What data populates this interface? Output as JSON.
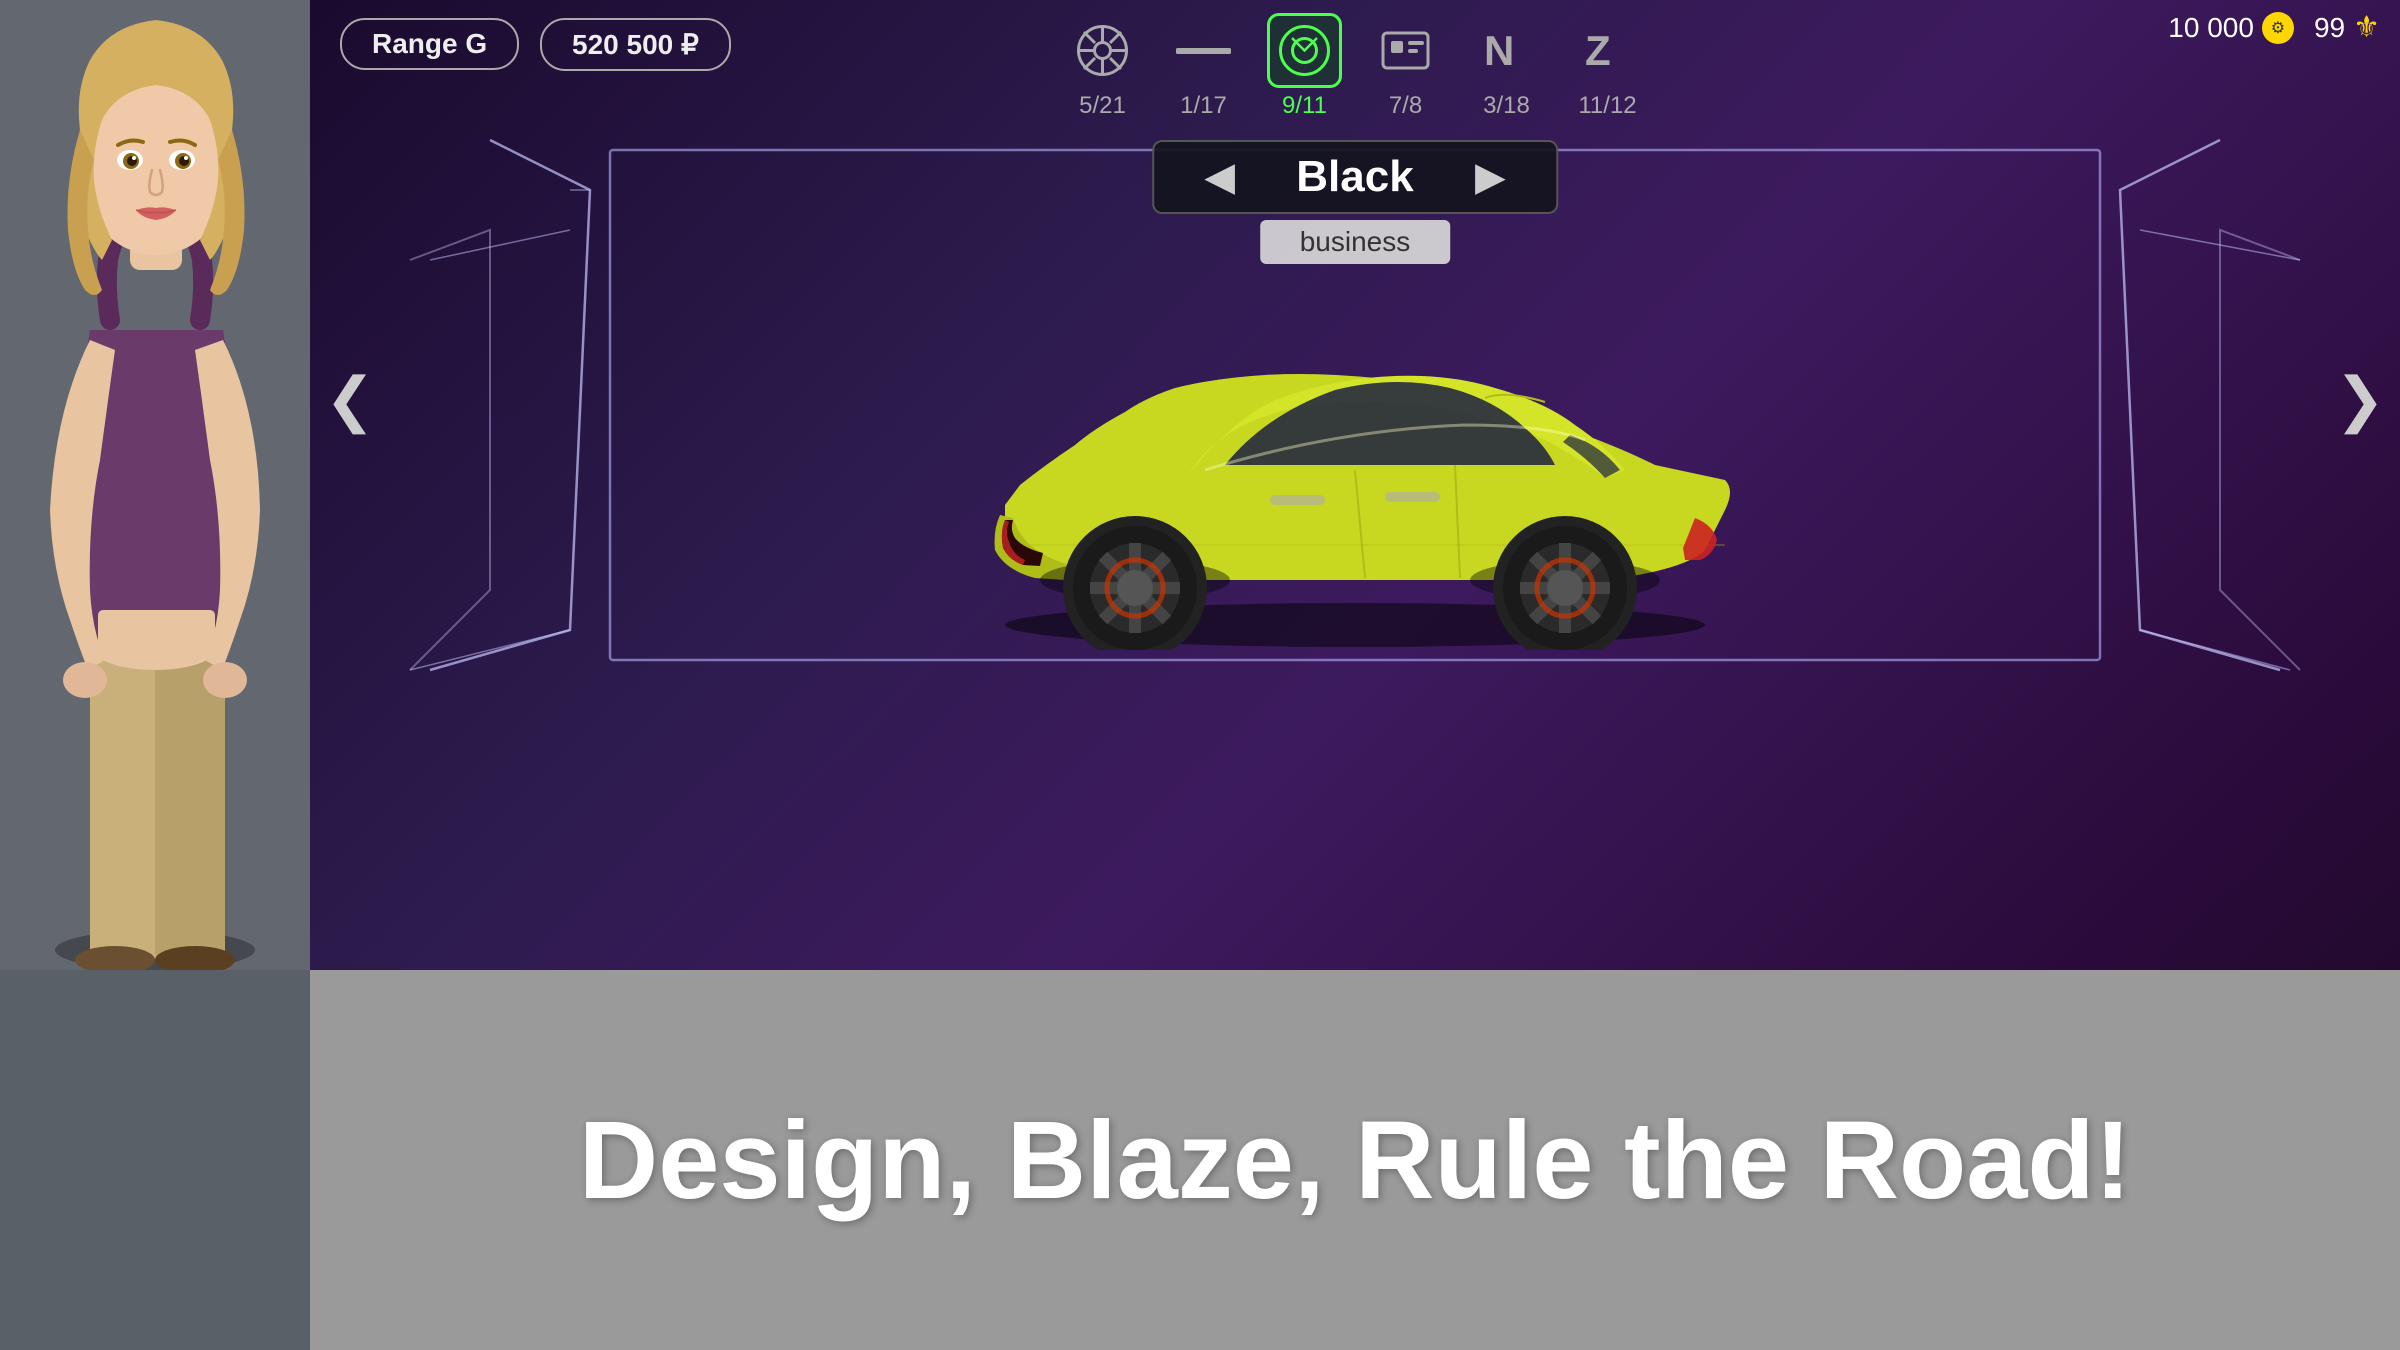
{
  "header": {
    "range_label": "Range G",
    "price_label": "520 500 ₽",
    "currency_coins": "10 000",
    "currency_gems": "99"
  },
  "tabs": [
    {
      "id": "wheels",
      "icon": "wheel",
      "count": "5/21",
      "active": false
    },
    {
      "id": "stripe",
      "icon": "stripe",
      "count": "1/17",
      "active": false
    },
    {
      "id": "emblem",
      "icon": "emblem",
      "count": "9/11",
      "active": true
    },
    {
      "id": "decal",
      "icon": "decal",
      "count": "7/8",
      "active": false
    },
    {
      "id": "neon",
      "icon": "neon",
      "count": "3/18",
      "active": false
    },
    {
      "id": "special",
      "icon": "special",
      "count": "11/12",
      "active": false
    }
  ],
  "color": {
    "name": "Black",
    "type": "business",
    "arrow_left": "◀",
    "arrow_right": "▶"
  },
  "nav": {
    "left_arrow": "❮",
    "right_arrow": "❯"
  },
  "tagline": "Design, Blaze, Rule the Road!"
}
